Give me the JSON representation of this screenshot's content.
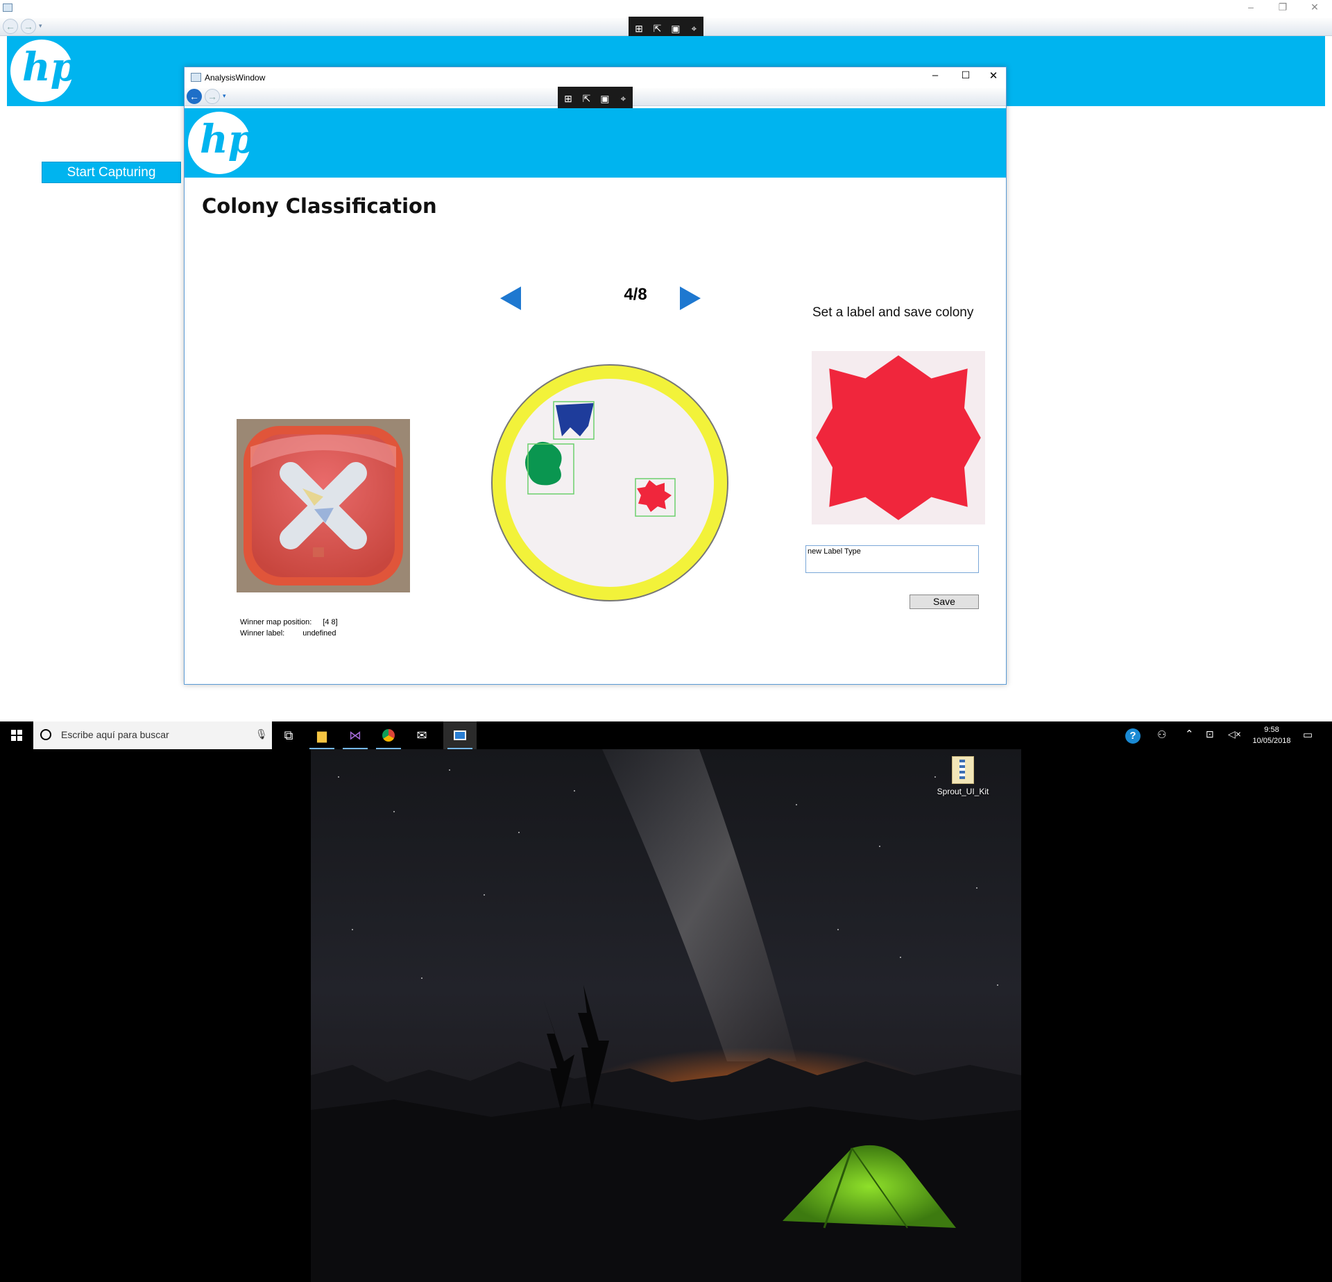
{
  "main_window": {
    "controls": {
      "minimize": "–",
      "restore": "❐",
      "close": "✕"
    },
    "logo_text": "hp",
    "start_button_label": "Start Capturing"
  },
  "analysis_window": {
    "title": "AnalysisWindow",
    "controls": {
      "minimize": "–",
      "maximize": "☐",
      "close": "✕"
    },
    "logo_text": "hp",
    "page_title": "Colony Classification",
    "pager": {
      "counter": "4/8"
    },
    "winner": {
      "position_label": "Winner map position:",
      "position_value": "[4 8]",
      "label_label": "Winner label:",
      "label_value": "undefined"
    },
    "label_panel": {
      "heading": "Set a label and save colony",
      "input_value": "new Label Type",
      "save_label": "Save"
    }
  },
  "taskbar": {
    "search_placeholder": "Escribe aquí para buscar",
    "clock_time": "9:58",
    "clock_date": "10/05/2018",
    "apps": [
      "file-explorer",
      "visual-studio",
      "chrome",
      "mail",
      "analysis-app"
    ]
  },
  "desktop": {
    "icons": [
      {
        "label": "Sprout_UI_Kit"
      }
    ]
  },
  "colors": {
    "brand_blue": "#00b4ef",
    "colony_red": "#f0263c",
    "colony_blue": "#1e3c9b",
    "colony_green": "#0a9650",
    "dish_rim": "#f2f23a"
  }
}
